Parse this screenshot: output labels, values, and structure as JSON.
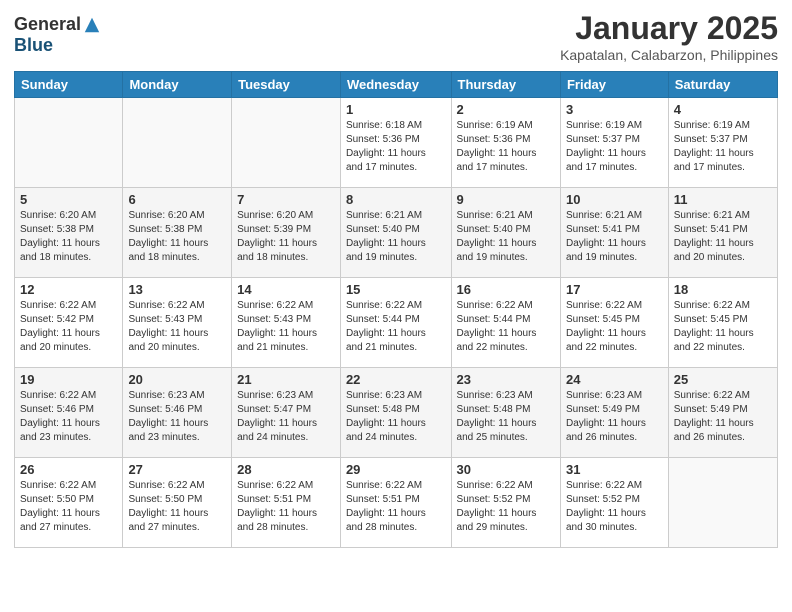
{
  "logo": {
    "general": "General",
    "blue": "Blue"
  },
  "header": {
    "title": "January 2025",
    "location": "Kapatalan, Calabarzon, Philippines"
  },
  "weekdays": [
    "Sunday",
    "Monday",
    "Tuesday",
    "Wednesday",
    "Thursday",
    "Friday",
    "Saturday"
  ],
  "weeks": [
    [
      {
        "day": "",
        "info": ""
      },
      {
        "day": "",
        "info": ""
      },
      {
        "day": "",
        "info": ""
      },
      {
        "day": "1",
        "info": "Sunrise: 6:18 AM\nSunset: 5:36 PM\nDaylight: 11 hours\nand 17 minutes."
      },
      {
        "day": "2",
        "info": "Sunrise: 6:19 AM\nSunset: 5:36 PM\nDaylight: 11 hours\nand 17 minutes."
      },
      {
        "day": "3",
        "info": "Sunrise: 6:19 AM\nSunset: 5:37 PM\nDaylight: 11 hours\nand 17 minutes."
      },
      {
        "day": "4",
        "info": "Sunrise: 6:19 AM\nSunset: 5:37 PM\nDaylight: 11 hours\nand 17 minutes."
      }
    ],
    [
      {
        "day": "5",
        "info": "Sunrise: 6:20 AM\nSunset: 5:38 PM\nDaylight: 11 hours\nand 18 minutes."
      },
      {
        "day": "6",
        "info": "Sunrise: 6:20 AM\nSunset: 5:38 PM\nDaylight: 11 hours\nand 18 minutes."
      },
      {
        "day": "7",
        "info": "Sunrise: 6:20 AM\nSunset: 5:39 PM\nDaylight: 11 hours\nand 18 minutes."
      },
      {
        "day": "8",
        "info": "Sunrise: 6:21 AM\nSunset: 5:40 PM\nDaylight: 11 hours\nand 19 minutes."
      },
      {
        "day": "9",
        "info": "Sunrise: 6:21 AM\nSunset: 5:40 PM\nDaylight: 11 hours\nand 19 minutes."
      },
      {
        "day": "10",
        "info": "Sunrise: 6:21 AM\nSunset: 5:41 PM\nDaylight: 11 hours\nand 19 minutes."
      },
      {
        "day": "11",
        "info": "Sunrise: 6:21 AM\nSunset: 5:41 PM\nDaylight: 11 hours\nand 20 minutes."
      }
    ],
    [
      {
        "day": "12",
        "info": "Sunrise: 6:22 AM\nSunset: 5:42 PM\nDaylight: 11 hours\nand 20 minutes."
      },
      {
        "day": "13",
        "info": "Sunrise: 6:22 AM\nSunset: 5:43 PM\nDaylight: 11 hours\nand 20 minutes."
      },
      {
        "day": "14",
        "info": "Sunrise: 6:22 AM\nSunset: 5:43 PM\nDaylight: 11 hours\nand 21 minutes."
      },
      {
        "day": "15",
        "info": "Sunrise: 6:22 AM\nSunset: 5:44 PM\nDaylight: 11 hours\nand 21 minutes."
      },
      {
        "day": "16",
        "info": "Sunrise: 6:22 AM\nSunset: 5:44 PM\nDaylight: 11 hours\nand 22 minutes."
      },
      {
        "day": "17",
        "info": "Sunrise: 6:22 AM\nSunset: 5:45 PM\nDaylight: 11 hours\nand 22 minutes."
      },
      {
        "day": "18",
        "info": "Sunrise: 6:22 AM\nSunset: 5:45 PM\nDaylight: 11 hours\nand 22 minutes."
      }
    ],
    [
      {
        "day": "19",
        "info": "Sunrise: 6:22 AM\nSunset: 5:46 PM\nDaylight: 11 hours\nand 23 minutes."
      },
      {
        "day": "20",
        "info": "Sunrise: 6:23 AM\nSunset: 5:46 PM\nDaylight: 11 hours\nand 23 minutes."
      },
      {
        "day": "21",
        "info": "Sunrise: 6:23 AM\nSunset: 5:47 PM\nDaylight: 11 hours\nand 24 minutes."
      },
      {
        "day": "22",
        "info": "Sunrise: 6:23 AM\nSunset: 5:48 PM\nDaylight: 11 hours\nand 24 minutes."
      },
      {
        "day": "23",
        "info": "Sunrise: 6:23 AM\nSunset: 5:48 PM\nDaylight: 11 hours\nand 25 minutes."
      },
      {
        "day": "24",
        "info": "Sunrise: 6:23 AM\nSunset: 5:49 PM\nDaylight: 11 hours\nand 26 minutes."
      },
      {
        "day": "25",
        "info": "Sunrise: 6:22 AM\nSunset: 5:49 PM\nDaylight: 11 hours\nand 26 minutes."
      }
    ],
    [
      {
        "day": "26",
        "info": "Sunrise: 6:22 AM\nSunset: 5:50 PM\nDaylight: 11 hours\nand 27 minutes."
      },
      {
        "day": "27",
        "info": "Sunrise: 6:22 AM\nSunset: 5:50 PM\nDaylight: 11 hours\nand 27 minutes."
      },
      {
        "day": "28",
        "info": "Sunrise: 6:22 AM\nSunset: 5:51 PM\nDaylight: 11 hours\nand 28 minutes."
      },
      {
        "day": "29",
        "info": "Sunrise: 6:22 AM\nSunset: 5:51 PM\nDaylight: 11 hours\nand 28 minutes."
      },
      {
        "day": "30",
        "info": "Sunrise: 6:22 AM\nSunset: 5:52 PM\nDaylight: 11 hours\nand 29 minutes."
      },
      {
        "day": "31",
        "info": "Sunrise: 6:22 AM\nSunset: 5:52 PM\nDaylight: 11 hours\nand 30 minutes."
      },
      {
        "day": "",
        "info": ""
      }
    ]
  ]
}
